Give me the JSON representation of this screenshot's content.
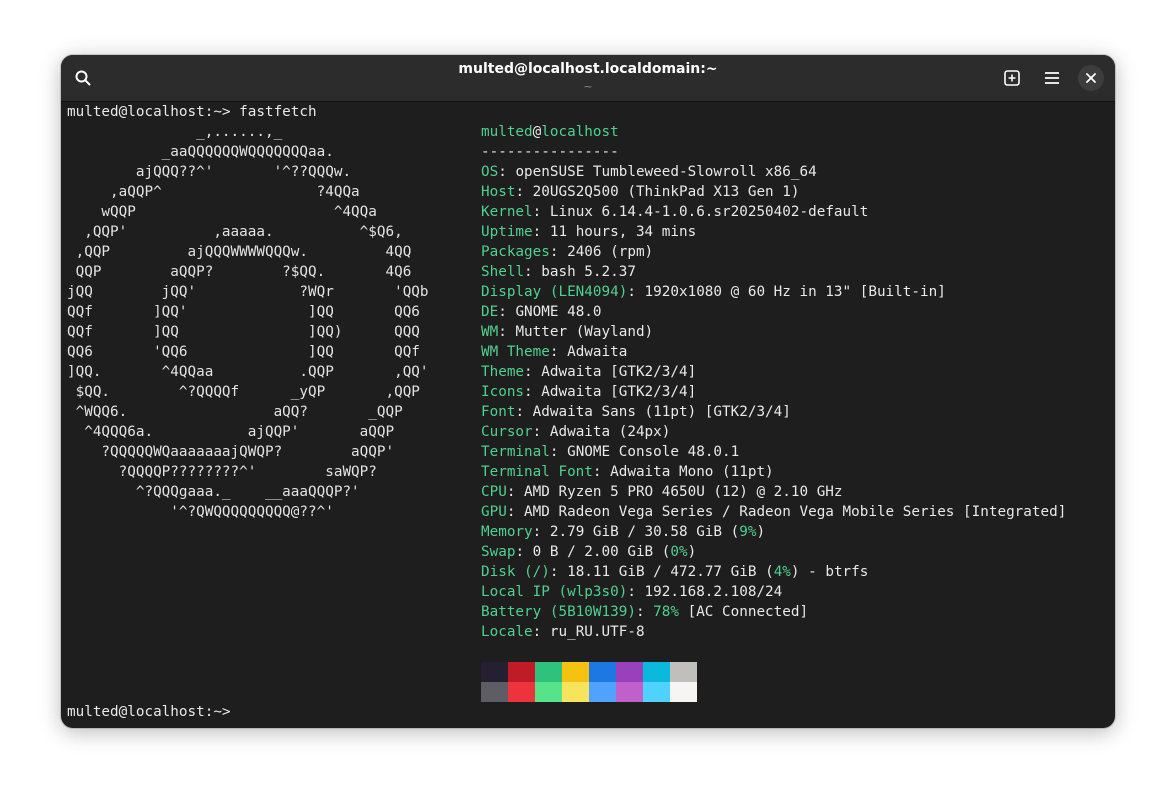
{
  "window": {
    "title": "multed@localhost.localdomain:~",
    "subtitle": "~"
  },
  "terminal": {
    "command_line": "multed@localhost:~> fastfetch",
    "final_prompt": "multed@localhost:~> ",
    "logo_lines": [
      "               _,......,_",
      "           _aaQQQQQQWQQQQQQQaa.",
      "        ajQQQ??^'       '^??QQQw.",
      "     ,aQQP^                  ?4QQa",
      "    wQQP                       ^4QQa",
      "  ,QQP'          ,aaaaa.          ^$Q6,",
      " ,QQP         ajQQQWWWWQQQw.         4QQ",
      " QQP        aQQP?        ?$QQ.       4Q6",
      "jQQ        jQQ'            ?WQr       'QQb",
      "QQf       ]QQ'              ]QQ       QQ6",
      "QQf       ]QQ               ]QQ)      QQQ",
      "QQ6       'QQ6              ]QQ       QQf",
      "]QQ.       ^4QQaa          .QQP       ,QQ'",
      " $QQ.        ^?QQQQf      _yQP       ,QQP",
      " ^WQQ6.                 aQQ?       _QQP",
      "  ^4QQQ6a.           ajQQP'       aQQP",
      "    ?QQQQQWQaaaaaaajQWQP?        aQQP'",
      "      ?QQQQP????????^'        saWQP?",
      "        ^?QQQgaaa._    __aaaQQQP?'",
      "            '^?QWQQQQQQQQQ@??^'"
    ],
    "user": "multed",
    "at": "@",
    "host": "localhost",
    "separator": "----------------",
    "info": [
      {
        "key": "OS",
        "value": "openSUSE Tumbleweed-Slowroll x86_64"
      },
      {
        "key": "Host",
        "value": "20UGS2Q500 (ThinkPad X13 Gen 1)"
      },
      {
        "key": "Kernel",
        "value": "Linux 6.14.4-1.0.6.sr20250402-default"
      },
      {
        "key": "Uptime",
        "value": "11 hours, 34 mins"
      },
      {
        "key": "Packages",
        "value": "2406 (rpm)"
      },
      {
        "key": "Shell",
        "value": "bash 5.2.37"
      },
      {
        "key": "Display (LEN4094)",
        "value": "1920x1080 @ 60 Hz in 13\" [Built-in]"
      },
      {
        "key": "DE",
        "value": "GNOME 48.0"
      },
      {
        "key": "WM",
        "value": "Mutter (Wayland)"
      },
      {
        "key": "WM Theme",
        "value": "Adwaita"
      },
      {
        "key": "Theme",
        "value": "Adwaita [GTK2/3/4]"
      },
      {
        "key": "Icons",
        "value": "Adwaita [GTK2/3/4]"
      },
      {
        "key": "Font",
        "value": "Adwaita Sans (11pt) [GTK2/3/4]"
      },
      {
        "key": "Cursor",
        "value": "Adwaita (24px)"
      },
      {
        "key": "Terminal",
        "value": "GNOME Console 48.0.1"
      },
      {
        "key": "Terminal Font",
        "value": "Adwaita Mono (11pt)"
      },
      {
        "key": "CPU",
        "value": "AMD Ryzen 5 PRO 4650U (12) @ 2.10 GHz"
      },
      {
        "key": "GPU",
        "value": "AMD Radeon Vega Series / Radeon Vega Mobile Series [Integrated]"
      },
      {
        "key": "Memory",
        "value": "2.79 GiB / 30.58 GiB (",
        "pct": "9%",
        "suffix": ")"
      },
      {
        "key": "Swap",
        "value": "0 B / 2.00 GiB (",
        "pct": "0%",
        "suffix": ")"
      },
      {
        "key": "Disk (/)",
        "value": "18.11 GiB / 472.77 GiB (",
        "pct": "4%",
        "suffix": ") - btrfs"
      },
      {
        "key": "Local IP (wlp3s0)",
        "value": "192.168.2.108/24"
      },
      {
        "key": "Battery (5B10W139)",
        "value": "",
        "pct": "78%",
        "suffix": " [AC Connected]"
      },
      {
        "key": "Locale",
        "value": "ru_RU.UTF-8"
      }
    ],
    "palette_top": [
      "#241f31",
      "#c01c28",
      "#2ec27e",
      "#f5c211",
      "#1e78e4",
      "#9841bb",
      "#0ab9dc",
      "#c0bfbc"
    ],
    "palette_bottom": [
      "#5e5c64",
      "#ed333b",
      "#57e389",
      "#f8e45c",
      "#51a1ff",
      "#c061cb",
      "#4fd2fd",
      "#f6f5f4"
    ]
  }
}
